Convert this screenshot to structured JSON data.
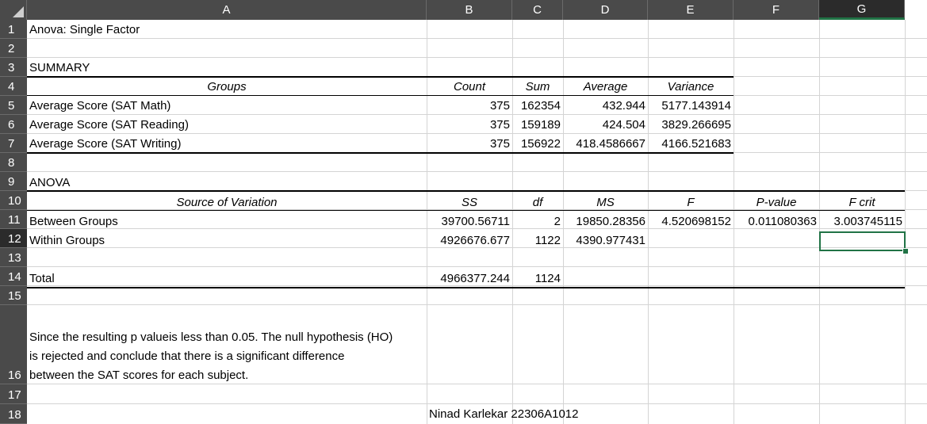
{
  "columns": [
    "A",
    "B",
    "C",
    "D",
    "E",
    "F",
    "G"
  ],
  "selected_column": "G",
  "rows": [
    "1",
    "2",
    "3",
    "4",
    "5",
    "6",
    "7",
    "8",
    "9",
    "10",
    "11",
    "12",
    "13",
    "14",
    "15",
    "16",
    "17",
    "18"
  ],
  "selected_row": "12",
  "cells": {
    "A1": "Anova: Single Factor",
    "A3": "SUMMARY",
    "A4": "Groups",
    "B4": "Count",
    "C4": "Sum",
    "D4": "Average",
    "E4": "Variance",
    "A5": "Average Score (SAT Math)",
    "B5": "375",
    "C5": "162354",
    "D5": "432.944",
    "E5": "5177.143914",
    "A6": "Average Score (SAT Reading)",
    "B6": "375",
    "C6": "159189",
    "D6": "424.504",
    "E6": "3829.266695",
    "A7": "Average Score (SAT Writing)",
    "B7": "375",
    "C7": "156922",
    "D7": "418.4586667",
    "E7": "4166.521683",
    "A9": "ANOVA",
    "A10": "Source of Variation",
    "B10": "SS",
    "C10": "df",
    "D10": "MS",
    "E10": "F",
    "F10": "P-value",
    "G10": "F crit",
    "A11": "Between Groups",
    "B11": "39700.56711",
    "C11": "2",
    "D11": "19850.28356",
    "E11": "4.520698152",
    "F11": "0.011080363",
    "G11": "3.003745115",
    "A12": "Within Groups",
    "B12": "4926676.677",
    "C12": "1122",
    "D12": "4390.977431",
    "A14": "Total",
    "B14": "4966377.244",
    "C14": "1124",
    "A16_line1": "Since the resulting p valueis less than 0.05. The null hypothesis (HO)",
    "A16_line2": "is rejected and conclude that there is a significant difference",
    "A16_line3": "between the SAT scores for each subject.",
    "B18": "Ninad Karlekar 22306A1012"
  },
  "colors": {
    "header_bg": "#4a4a4a",
    "selection_accent": "#217346"
  }
}
